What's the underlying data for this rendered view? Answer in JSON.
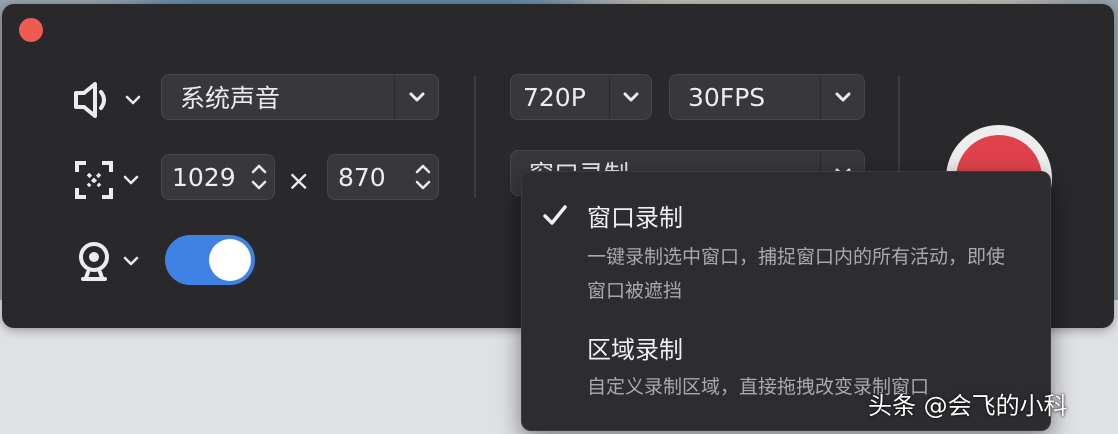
{
  "audio": {
    "icon": "speaker-icon",
    "source_value": "系统声音"
  },
  "resolution": {
    "value": "720P"
  },
  "framerate": {
    "value": "30FPS"
  },
  "region": {
    "icon": "region-select-icon",
    "width": "1029",
    "separator": "×",
    "height": "870"
  },
  "camera": {
    "icon": "webcam-icon",
    "enabled": true
  },
  "mode_select": {
    "current": "窗口录制",
    "options": [
      {
        "title": "窗口录制",
        "desc": "一键录制选中窗口，捕捉窗口内的所有活动，即使窗口被遮挡",
        "selected": true
      },
      {
        "title": "区域录制",
        "desc": "自定义录制区域，直接拖拽改变录制窗口",
        "selected": false
      }
    ]
  },
  "watermark": "头条 @会飞的小科",
  "colors": {
    "panel": "#29292c",
    "accent_toggle": "#3f82e3",
    "record": "#e0424d",
    "close": "#ee5b52"
  }
}
